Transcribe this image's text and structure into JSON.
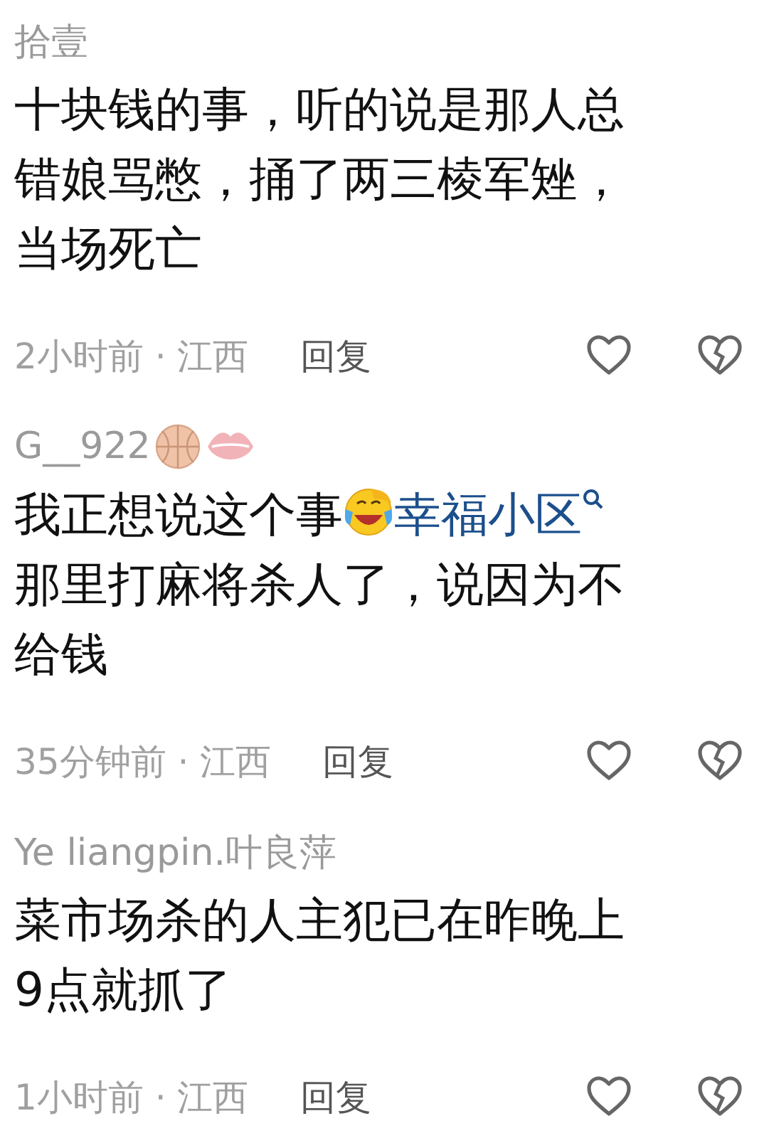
{
  "comments": [
    {
      "author": "拾壹",
      "lines": [
        [
          {
            "kind": "text",
            "text": "十块钱的事，听的说是那人总"
          }
        ],
        [
          {
            "kind": "text",
            "text": "错娘骂憋，捅了两三棱军矬，"
          }
        ],
        [
          {
            "kind": "text",
            "text": "当场死亡"
          }
        ]
      ],
      "time": "2小时前 · 江西",
      "reply": "回复"
    },
    {
      "author": "G__922",
      "badges": [
        {
          "kind": "ball"
        },
        {
          "kind": "lips"
        }
      ],
      "lines": [
        [
          {
            "kind": "text",
            "text": "我正想说这个事"
          },
          {
            "kind": "emoji"
          },
          {
            "kind": "link",
            "text": "幸福小区"
          }
        ],
        [
          {
            "kind": "text",
            "text": "那里打麻将杀人了，说因为不"
          }
        ],
        [
          {
            "kind": "text",
            "text": "给钱"
          }
        ]
      ],
      "time": "35分钟前 · 江西",
      "reply": "回复"
    },
    {
      "author": "Ye liangpin.叶良萍",
      "lines": [
        [
          {
            "kind": "text",
            "text": "菜市场杀的人主犯已在昨晚上"
          }
        ],
        [
          {
            "kind": "text",
            "text": "9点就抓了"
          }
        ]
      ],
      "time": "1小时前 · 江西",
      "reply": "回复"
    }
  ]
}
